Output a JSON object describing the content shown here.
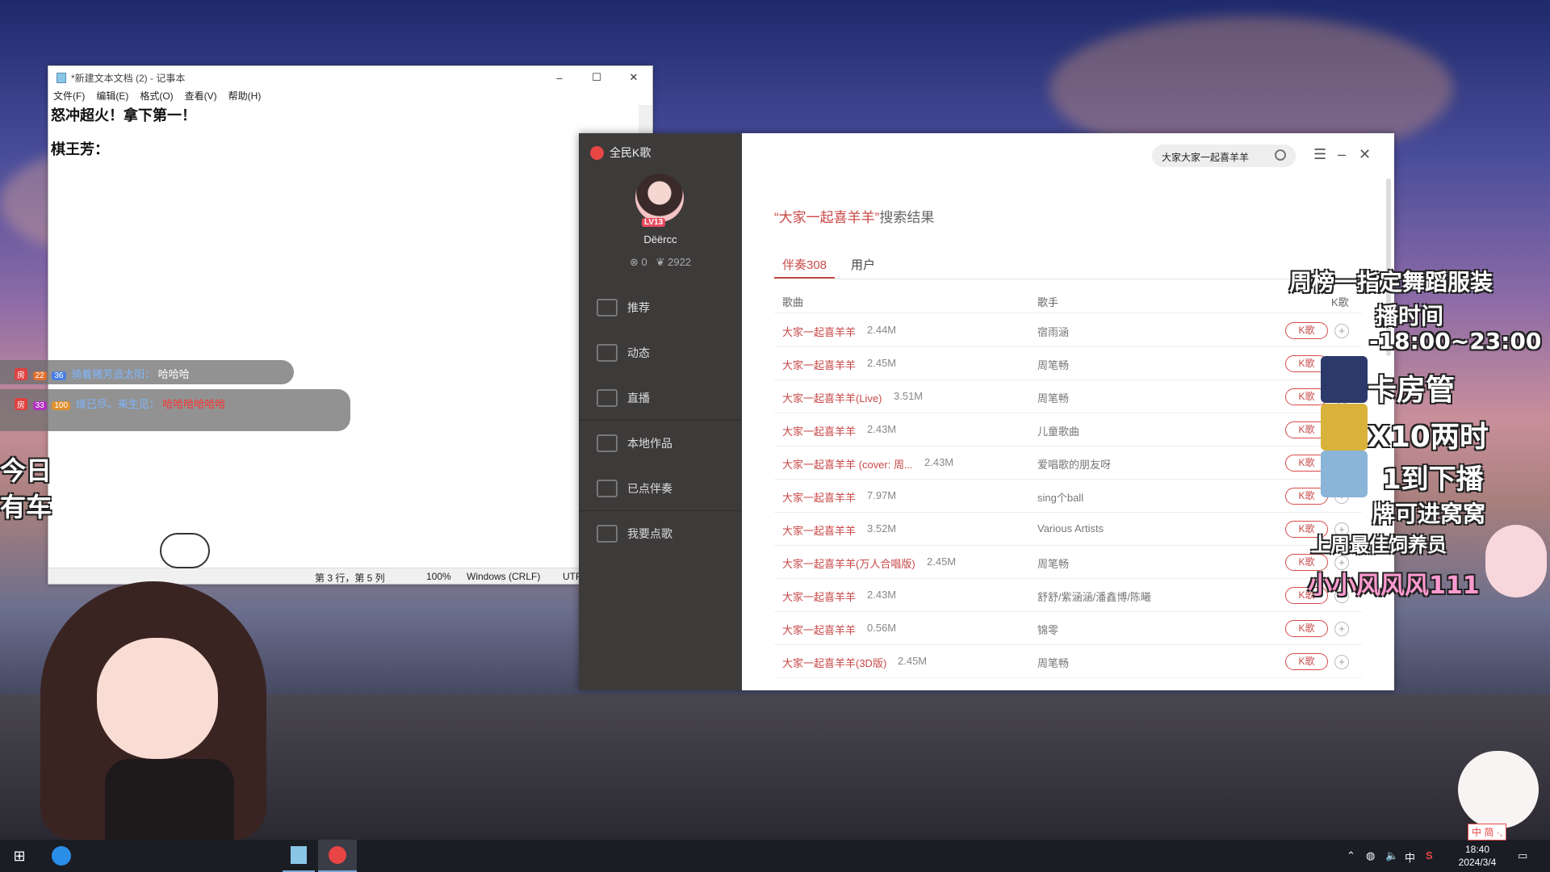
{
  "notepad": {
    "title": "*新建文本文档 (2) - 记事本",
    "menu": [
      "文件(F)",
      "编辑(E)",
      "格式(O)",
      "查看(V)",
      "帮助(H)"
    ],
    "lines": [
      "怒冲超火！拿下第一！",
      "棋王芳："
    ],
    "status": {
      "position": "第 3 行，第 5 列",
      "zoom": "100%",
      "eol": "Windows (CRLF)",
      "encoding": "UTF"
    },
    "win_controls": {
      "minimize": "–",
      "maximize": "☐",
      "close": "✕"
    }
  },
  "karaoke": {
    "app_name": "全民K歌",
    "user": {
      "level": "LV13",
      "name": "Dëërcc",
      "stat_a": "0",
      "stat_b": "2922"
    },
    "nav": [
      "推荐",
      "动态",
      "直播",
      "本地作品",
      "已点伴奏",
      "我要点歌"
    ],
    "search_value": "大家大家一起喜羊羊",
    "result_query": "“大家一起喜羊羊”",
    "result_suffix": "搜索结果",
    "tabs": [
      {
        "label": "伴奏308",
        "active": true
      },
      {
        "label": "用户",
        "active": false
      }
    ],
    "columns": {
      "song": "歌曲",
      "artist": "歌手",
      "k": "K歌"
    },
    "k_label": "K歌",
    "rows": [
      {
        "song": "大家一起喜羊羊",
        "size": "2.44M",
        "artist": "宿雨涵"
      },
      {
        "song": "大家一起喜羊羊",
        "size": "2.45M",
        "artist": "周笔畅"
      },
      {
        "song": "大家一起喜羊羊(Live)",
        "size": "3.51M",
        "artist": "周笔畅"
      },
      {
        "song": "大家一起喜羊羊",
        "size": "2.43M",
        "artist": "儿童歌曲"
      },
      {
        "song": "大家一起喜羊羊 (cover: 周...",
        "size": "2.43M",
        "artist": "爱唱歌的朋友呀"
      },
      {
        "song": "大家一起喜羊羊",
        "size": "7.97M",
        "artist": "sing个ball"
      },
      {
        "song": "大家一起喜羊羊",
        "size": "3.52M",
        "artist": "Various Artists"
      },
      {
        "song": "大家一起喜羊羊(万人合唱版)",
        "size": "2.45M",
        "artist": "周笔畅"
      },
      {
        "song": "大家一起喜羊羊",
        "size": "2.43M",
        "artist": "舒舒/紫涵涵/潘鑫博/陈曦"
      },
      {
        "song": "大家一起喜羊羊",
        "size": "0.56M",
        "artist": "锦零"
      },
      {
        "song": "大家一起喜羊羊(3D版)",
        "size": "2.45M",
        "artist": "周笔畅"
      }
    ]
  },
  "chat": [
    {
      "badges": [
        "房",
        "22",
        "36"
      ],
      "nick": "骑着猪芳追太阳：",
      "msg": "哈哈哈"
    },
    {
      "badges": [
        "房",
        "33",
        "100"
      ],
      "nick": "缘已尽、来生见：",
      "msg": "哈哈哈哈哈哈"
    }
  ],
  "overlay": {
    "left_lines": [
      "今日",
      "有车"
    ],
    "right_lines": [
      "周榜一指定舞蹈服装",
      "播时间",
      "-18:00~23:00",
      "卡房管",
      "X10两时",
      "1到下播",
      "牌可进窝窝"
    ],
    "best_feeder": "上周最佳饲养员",
    "feeder_name": "小小风风风111"
  },
  "taskbar": {
    "time": "18:40",
    "date": "2024/3/4",
    "ime": "中",
    "tray_ime_bar": "中 简 ·,"
  }
}
